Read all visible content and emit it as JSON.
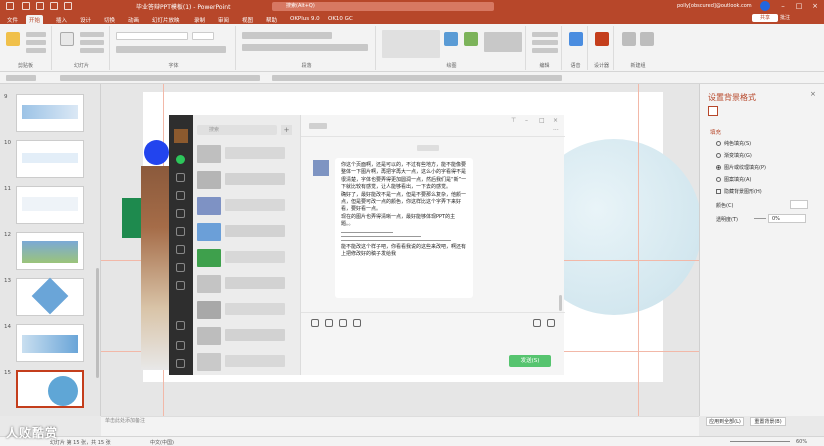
{
  "window": {
    "title": "毕业答辩PPT模板(1) - PowerPoint",
    "search_placeholder": "搜索(Alt+Q)",
    "user": "polly[obscured]@outlook.com"
  },
  "tabs": [
    "文件",
    "开始",
    "插入",
    "设计",
    "切换",
    "动画",
    "幻灯片放映",
    "录制",
    "审阅",
    "视图",
    "帮助",
    "OKPlus 9.0",
    "OK10 GC"
  ],
  "active_tab": "开始",
  "share_label": "共享",
  "comment_label": "批注",
  "ribbon_groups": [
    "剪贴板",
    "幻灯片",
    "字体",
    "段落",
    "绘图",
    "编辑",
    "语音",
    "设计器",
    "新建组"
  ],
  "slides": [
    {
      "num": "9"
    },
    {
      "num": "10"
    },
    {
      "num": "11"
    },
    {
      "num": "12"
    },
    {
      "num": "13"
    },
    {
      "num": "14"
    },
    {
      "num": "15"
    }
  ],
  "wechat": {
    "search": "搜索",
    "message": [
      "你这个页面啊，还是可以的，不过有些地方，能不能像要整体一下图片啊，再把字再大一点，这么小的字看得不是很清楚，字体也要弄得更加圆润一点，然后我们是“新”一下就比较有感觉，让人能够看出，一下去的感觉。",
      "确好了，最好能改不是一点，但是不要那么复杂，他颜一点，但是要可改一点的颜色，你这样比这个字弄下来好看，要好看一点。",
      "现在的图片也弄得清晰一点，最好能够体现PPT的主题。。"
    ],
    "message_tail": "能不能改这个样子吧，你看看我说的这些来改吧，啊还有上把修改好的稿子发给我",
    "send": "发送(S)"
  },
  "format_panel": {
    "title": "设置背景格式",
    "section": "填充",
    "options": [
      "纯色填充(S)",
      "渐变填充(G)",
      "图片或纹理填充(P)",
      "图案填充(A)",
      "隐藏背景图形(H)"
    ],
    "color_label": "颜色(C)",
    "transparency_label": "透明度(T)",
    "transparency_value": "0%",
    "apply_all": "应用到全部(L)",
    "reset": "重置背景(B)"
  },
  "status": {
    "slide": "幻灯片 第 15 张，共 15 张",
    "lang": "中文(中国)",
    "notes": "单击此处添加备注",
    "zoom": "60%"
  },
  "watermark": "人败酷赏"
}
